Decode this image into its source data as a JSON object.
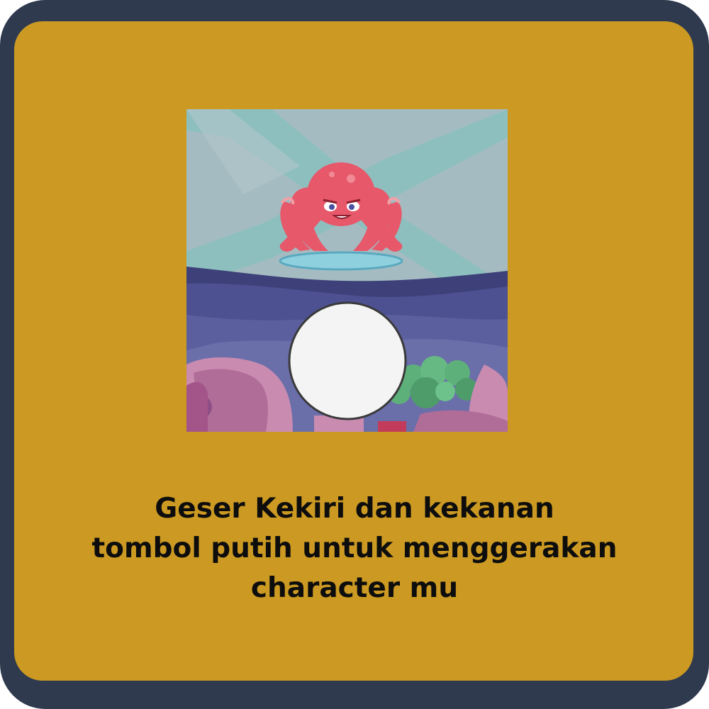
{
  "colors": {
    "frame": "#2f3a4f",
    "panel": "#cc9a22",
    "sky": "#9fb8bd",
    "sea_ribbon": "#7fb9b8",
    "platform": "#8fd0de",
    "rock": "#4a4f8e",
    "octopus": "#e6586a",
    "coral": "#c98bb0",
    "bush": "#5eb07a",
    "button": "#f4f4f4"
  },
  "preview": {
    "character": "octopus",
    "control": "white-slider-button"
  },
  "instruction": {
    "line1": "Geser Kekiri dan kekanan",
    "line2": "tombol putih untuk menggerakan",
    "line3": "character mu"
  }
}
